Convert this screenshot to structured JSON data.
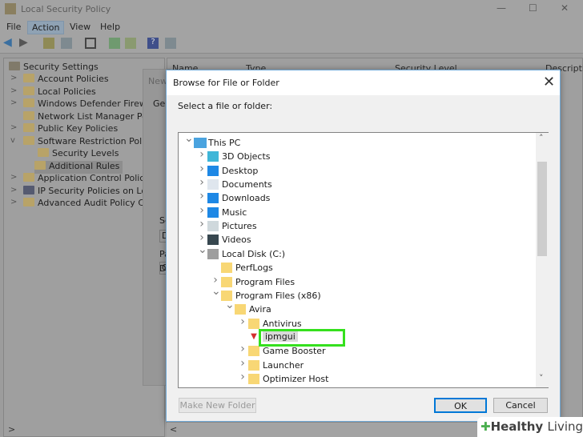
{
  "app": {
    "title": "Local Security Policy",
    "menu": [
      "File",
      "Action",
      "View",
      "Help"
    ],
    "active_menu": "Action"
  },
  "left_tree": [
    {
      "label": "Security Settings",
      "chevron": ""
    },
    {
      "label": "Account Policies",
      "chevron": ">"
    },
    {
      "label": "Local Policies",
      "chevron": ">"
    },
    {
      "label": "Windows Defender Firewall",
      "chevron": ">"
    },
    {
      "label": "Network List Manager Polic",
      "chevron": ""
    },
    {
      "label": "Public Key Policies",
      "chevron": ">"
    },
    {
      "label": "Software Restriction Policie",
      "chevron": "v"
    },
    {
      "label": "Security Levels",
      "chevron": ""
    },
    {
      "label": "Additional Rules",
      "chevron": ""
    },
    {
      "label": "Application Control Policie",
      "chevron": ">"
    },
    {
      "label": "IP Security Policies on Loca",
      "chevron": ">"
    },
    {
      "label": "Advanced Audit Policy Con",
      "chevron": ">"
    }
  ],
  "columns": [
    "Name",
    "Type",
    "Security Level",
    "Descripti"
  ],
  "background_dialog": {
    "title": "New",
    "tab": "Ger",
    "labels": [
      "Pa",
      "C",
      "Se",
      "D",
      "De"
    ]
  },
  "browse_dialog": {
    "title": "Browse for File or Folder",
    "prompt": "Select a file or folder:",
    "tree": [
      {
        "label": "This PC",
        "level": 0,
        "chevron": "v",
        "icon": "pc-icon"
      },
      {
        "label": "3D Objects",
        "level": 1,
        "chevron": ">",
        "icon": "3d-objects-icon"
      },
      {
        "label": "Desktop",
        "level": 1,
        "chevron": ">",
        "icon": "desktop-icon"
      },
      {
        "label": "Documents",
        "level": 1,
        "chevron": ">",
        "icon": "documents-icon"
      },
      {
        "label": "Downloads",
        "level": 1,
        "chevron": ">",
        "icon": "downloads-icon"
      },
      {
        "label": "Music",
        "level": 1,
        "chevron": ">",
        "icon": "music-icon"
      },
      {
        "label": "Pictures",
        "level": 1,
        "chevron": ">",
        "icon": "pictures-icon"
      },
      {
        "label": "Videos",
        "level": 1,
        "chevron": ">",
        "icon": "videos-icon"
      },
      {
        "label": "Local Disk (C:)",
        "level": 1,
        "chevron": "v",
        "icon": "drive-icon"
      },
      {
        "label": "PerfLogs",
        "level": 2,
        "chevron": "",
        "icon": "folder-icon"
      },
      {
        "label": "Program Files",
        "level": 2,
        "chevron": ">",
        "icon": "folder-icon"
      },
      {
        "label": "Program Files (x86)",
        "level": 2,
        "chevron": "v",
        "icon": "folder-icon"
      },
      {
        "label": "Avira",
        "level": 3,
        "chevron": "v",
        "icon": "folder-icon"
      },
      {
        "label": "Antivirus",
        "level": 4,
        "chevron": ">",
        "icon": "folder-icon"
      },
      {
        "label": "ipmgui",
        "level": 4,
        "chevron": "",
        "icon": "avira-shield-icon",
        "selected": true
      },
      {
        "label": "Game Booster",
        "level": 4,
        "chevron": ">",
        "icon": "folder-icon"
      },
      {
        "label": "Launcher",
        "level": 4,
        "chevron": ">",
        "icon": "folder-icon"
      },
      {
        "label": "Optimizer Host",
        "level": 4,
        "chevron": ">",
        "icon": "folder-icon"
      }
    ],
    "buttons": {
      "new_folder": "Make New Folder",
      "ok": "OK",
      "cancel": "Cancel"
    },
    "highlight_color": "#35e01e"
  },
  "watermark": {
    "text1": "Healthy",
    "text2": "Living"
  }
}
